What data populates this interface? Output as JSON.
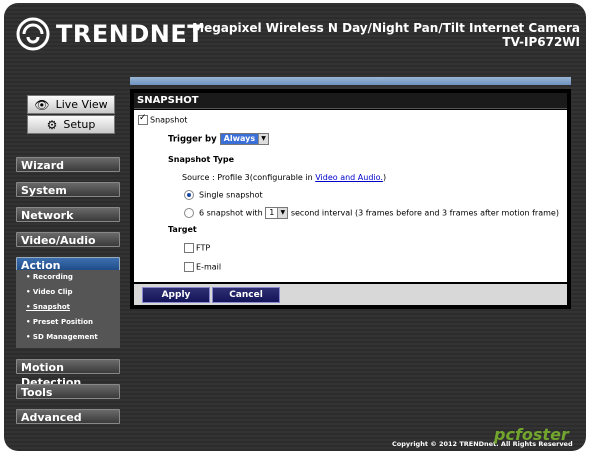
{
  "header": {
    "brand": "TRENDNET",
    "product_line1": "Megapixel Wireless N Day/Night Pan/Tilt Internet Camera",
    "product_line2": "TV-IP672WI"
  },
  "view_buttons": {
    "live_view": "Live View",
    "setup": "Setup"
  },
  "nav": {
    "wizard": "Wizard",
    "system": "System",
    "network": "Network",
    "video_audio": "Video/Audio",
    "action": "Action",
    "motion_detection": "Motion Detection",
    "tools": "Tools",
    "advanced": "Advanced"
  },
  "subnav": {
    "recording": "• Recording",
    "video_clip": "• Video Clip",
    "snapshot": "• Snapshot",
    "preset_position": "• Preset Position",
    "sd_management": "• SD Management"
  },
  "panel": {
    "title": "SNAPSHOT",
    "snapshot_label": "Snapshot",
    "trigger_label": "Trigger by",
    "trigger_value": "Always",
    "type_heading": "Snapshot Type",
    "source_text": "Source : Profile 3(configurable in ",
    "source_link": "Video and Audio.",
    "source_close": ")",
    "single_label": "Single snapshot",
    "multi_prefix": "6 snapshot with",
    "interval_value": "1",
    "multi_suffix": "second interval (3 frames before and 3 frames after motion frame)",
    "target_heading": "Target",
    "ftp_label": "FTP",
    "email_label": "E-mail"
  },
  "actions": {
    "apply": "Apply",
    "cancel": "Cancel"
  },
  "footer": {
    "copyright": "Copyright © 2012 TRENDnet. All Rights Reserved"
  },
  "watermark": "pcfoster",
  "state": {
    "snapshot_checked": true,
    "single_selected": true,
    "ftp_checked": false,
    "email_checked": false
  },
  "colors": {
    "accent_blue": "#1d4a86",
    "link": "#0000cc",
    "watermark_green": "#7ab32e"
  }
}
